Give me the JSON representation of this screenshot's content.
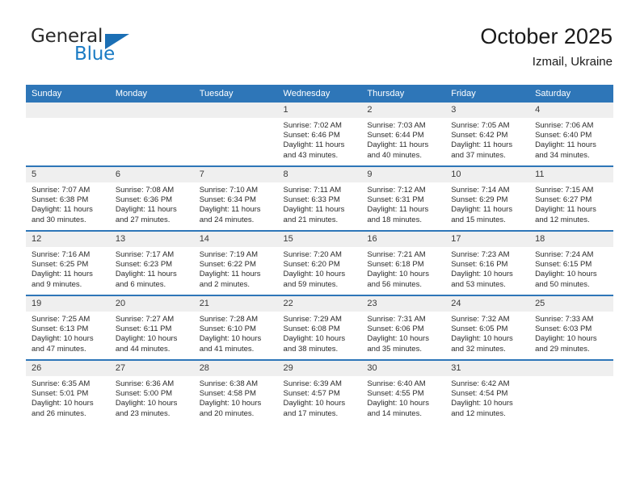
{
  "brand": {
    "name_top": "General",
    "name_bottom": "Blue",
    "triangle_color": "#1b6fb5",
    "text_color": "#2b2b2b",
    "blue_color": "#1a7bc4"
  },
  "header": {
    "title": "October 2025",
    "subtitle": "Izmail, Ukraine"
  },
  "theme": {
    "header_row_bg": "#2e76b8",
    "daynum_bg": "#efefef",
    "row_rule": "#2e76b8"
  },
  "calendar": {
    "weekday_headers": [
      "Sunday",
      "Monday",
      "Tuesday",
      "Wednesday",
      "Thursday",
      "Friday",
      "Saturday"
    ],
    "weeks": [
      [
        {
          "day": "",
          "empty": true,
          "sunrise": "",
          "sunset": "",
          "daylight_1": "",
          "daylight_2": ""
        },
        {
          "day": "",
          "empty": true,
          "sunrise": "",
          "sunset": "",
          "daylight_1": "",
          "daylight_2": ""
        },
        {
          "day": "",
          "empty": true,
          "sunrise": "",
          "sunset": "",
          "daylight_1": "",
          "daylight_2": ""
        },
        {
          "day": "1",
          "sunrise": "Sunrise: 7:02 AM",
          "sunset": "Sunset: 6:46 PM",
          "daylight_1": "Daylight: 11 hours",
          "daylight_2": "and 43 minutes."
        },
        {
          "day": "2",
          "sunrise": "Sunrise: 7:03 AM",
          "sunset": "Sunset: 6:44 PM",
          "daylight_1": "Daylight: 11 hours",
          "daylight_2": "and 40 minutes."
        },
        {
          "day": "3",
          "sunrise": "Sunrise: 7:05 AM",
          "sunset": "Sunset: 6:42 PM",
          "daylight_1": "Daylight: 11 hours",
          "daylight_2": "and 37 minutes."
        },
        {
          "day": "4",
          "sunrise": "Sunrise: 7:06 AM",
          "sunset": "Sunset: 6:40 PM",
          "daylight_1": "Daylight: 11 hours",
          "daylight_2": "and 34 minutes."
        }
      ],
      [
        {
          "day": "5",
          "sunrise": "Sunrise: 7:07 AM",
          "sunset": "Sunset: 6:38 PM",
          "daylight_1": "Daylight: 11 hours",
          "daylight_2": "and 30 minutes."
        },
        {
          "day": "6",
          "sunrise": "Sunrise: 7:08 AM",
          "sunset": "Sunset: 6:36 PM",
          "daylight_1": "Daylight: 11 hours",
          "daylight_2": "and 27 minutes."
        },
        {
          "day": "7",
          "sunrise": "Sunrise: 7:10 AM",
          "sunset": "Sunset: 6:34 PM",
          "daylight_1": "Daylight: 11 hours",
          "daylight_2": "and 24 minutes."
        },
        {
          "day": "8",
          "sunrise": "Sunrise: 7:11 AM",
          "sunset": "Sunset: 6:33 PM",
          "daylight_1": "Daylight: 11 hours",
          "daylight_2": "and 21 minutes."
        },
        {
          "day": "9",
          "sunrise": "Sunrise: 7:12 AM",
          "sunset": "Sunset: 6:31 PM",
          "daylight_1": "Daylight: 11 hours",
          "daylight_2": "and 18 minutes."
        },
        {
          "day": "10",
          "sunrise": "Sunrise: 7:14 AM",
          "sunset": "Sunset: 6:29 PM",
          "daylight_1": "Daylight: 11 hours",
          "daylight_2": "and 15 minutes."
        },
        {
          "day": "11",
          "sunrise": "Sunrise: 7:15 AM",
          "sunset": "Sunset: 6:27 PM",
          "daylight_1": "Daylight: 11 hours",
          "daylight_2": "and 12 minutes."
        }
      ],
      [
        {
          "day": "12",
          "sunrise": "Sunrise: 7:16 AM",
          "sunset": "Sunset: 6:25 PM",
          "daylight_1": "Daylight: 11 hours",
          "daylight_2": "and 9 minutes."
        },
        {
          "day": "13",
          "sunrise": "Sunrise: 7:17 AM",
          "sunset": "Sunset: 6:23 PM",
          "daylight_1": "Daylight: 11 hours",
          "daylight_2": "and 6 minutes."
        },
        {
          "day": "14",
          "sunrise": "Sunrise: 7:19 AM",
          "sunset": "Sunset: 6:22 PM",
          "daylight_1": "Daylight: 11 hours",
          "daylight_2": "and 2 minutes."
        },
        {
          "day": "15",
          "sunrise": "Sunrise: 7:20 AM",
          "sunset": "Sunset: 6:20 PM",
          "daylight_1": "Daylight: 10 hours",
          "daylight_2": "and 59 minutes."
        },
        {
          "day": "16",
          "sunrise": "Sunrise: 7:21 AM",
          "sunset": "Sunset: 6:18 PM",
          "daylight_1": "Daylight: 10 hours",
          "daylight_2": "and 56 minutes."
        },
        {
          "day": "17",
          "sunrise": "Sunrise: 7:23 AM",
          "sunset": "Sunset: 6:16 PM",
          "daylight_1": "Daylight: 10 hours",
          "daylight_2": "and 53 minutes."
        },
        {
          "day": "18",
          "sunrise": "Sunrise: 7:24 AM",
          "sunset": "Sunset: 6:15 PM",
          "daylight_1": "Daylight: 10 hours",
          "daylight_2": "and 50 minutes."
        }
      ],
      [
        {
          "day": "19",
          "sunrise": "Sunrise: 7:25 AM",
          "sunset": "Sunset: 6:13 PM",
          "daylight_1": "Daylight: 10 hours",
          "daylight_2": "and 47 minutes."
        },
        {
          "day": "20",
          "sunrise": "Sunrise: 7:27 AM",
          "sunset": "Sunset: 6:11 PM",
          "daylight_1": "Daylight: 10 hours",
          "daylight_2": "and 44 minutes."
        },
        {
          "day": "21",
          "sunrise": "Sunrise: 7:28 AM",
          "sunset": "Sunset: 6:10 PM",
          "daylight_1": "Daylight: 10 hours",
          "daylight_2": "and 41 minutes."
        },
        {
          "day": "22",
          "sunrise": "Sunrise: 7:29 AM",
          "sunset": "Sunset: 6:08 PM",
          "daylight_1": "Daylight: 10 hours",
          "daylight_2": "and 38 minutes."
        },
        {
          "day": "23",
          "sunrise": "Sunrise: 7:31 AM",
          "sunset": "Sunset: 6:06 PM",
          "daylight_1": "Daylight: 10 hours",
          "daylight_2": "and 35 minutes."
        },
        {
          "day": "24",
          "sunrise": "Sunrise: 7:32 AM",
          "sunset": "Sunset: 6:05 PM",
          "daylight_1": "Daylight: 10 hours",
          "daylight_2": "and 32 minutes."
        },
        {
          "day": "25",
          "sunrise": "Sunrise: 7:33 AM",
          "sunset": "Sunset: 6:03 PM",
          "daylight_1": "Daylight: 10 hours",
          "daylight_2": "and 29 minutes."
        }
      ],
      [
        {
          "day": "26",
          "sunrise": "Sunrise: 6:35 AM",
          "sunset": "Sunset: 5:01 PM",
          "daylight_1": "Daylight: 10 hours",
          "daylight_2": "and 26 minutes."
        },
        {
          "day": "27",
          "sunrise": "Sunrise: 6:36 AM",
          "sunset": "Sunset: 5:00 PM",
          "daylight_1": "Daylight: 10 hours",
          "daylight_2": "and 23 minutes."
        },
        {
          "day": "28",
          "sunrise": "Sunrise: 6:38 AM",
          "sunset": "Sunset: 4:58 PM",
          "daylight_1": "Daylight: 10 hours",
          "daylight_2": "and 20 minutes."
        },
        {
          "day": "29",
          "sunrise": "Sunrise: 6:39 AM",
          "sunset": "Sunset: 4:57 PM",
          "daylight_1": "Daylight: 10 hours",
          "daylight_2": "and 17 minutes."
        },
        {
          "day": "30",
          "sunrise": "Sunrise: 6:40 AM",
          "sunset": "Sunset: 4:55 PM",
          "daylight_1": "Daylight: 10 hours",
          "daylight_2": "and 14 minutes."
        },
        {
          "day": "31",
          "sunrise": "Sunrise: 6:42 AM",
          "sunset": "Sunset: 4:54 PM",
          "daylight_1": "Daylight: 10 hours",
          "daylight_2": "and 12 minutes."
        },
        {
          "day": "",
          "empty": true,
          "sunrise": "",
          "sunset": "",
          "daylight_1": "",
          "daylight_2": ""
        }
      ]
    ]
  }
}
